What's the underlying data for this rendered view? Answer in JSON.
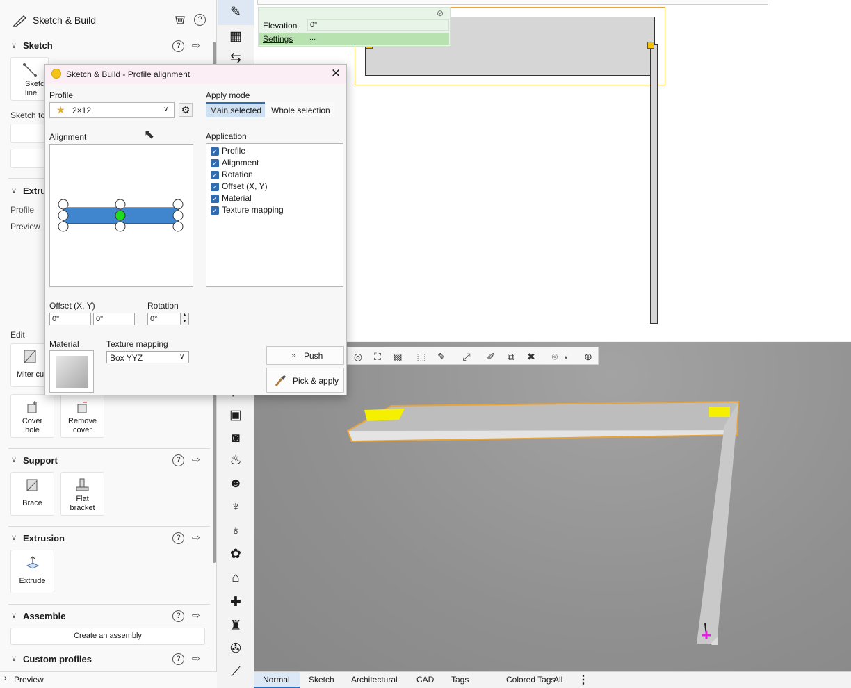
{
  "left_panel": {
    "app_title": "Sketch & Build",
    "sketch": {
      "title": "Sketch",
      "sketch_line_label": "Sketch line",
      "sketch_tools_label": "Sketch to"
    },
    "extrusion_top": {
      "title": "Extru",
      "profile_label": "Profile",
      "preview_label": "Preview"
    },
    "edit": {
      "title": "Edit",
      "miter_label": "Miter cu",
      "cover_hole_label": "Cover hole",
      "remove_cover_label": "Remove cover"
    },
    "support": {
      "title": "Support",
      "brace_label": "Brace",
      "flat_bracket_label": "Flat bracket"
    },
    "extrusion": {
      "title": "Extrusion",
      "extrude_label": "Extrude"
    },
    "assemble": {
      "title": "Assemble",
      "create_assembly_label": "Create an assembly"
    },
    "custom_profiles": {
      "title": "Custom profiles"
    },
    "preview_bar_label": "Preview"
  },
  "plan_view": {
    "settings_panel": {
      "elevation_label": "Elevation",
      "elevation_value": "0\"",
      "settings_label": "Settings",
      "settings_value": "..."
    }
  },
  "bottom_tabs": [
    "Normal",
    "Sketch",
    "Architectural",
    "CAD",
    "Tags",
    "Colored Tags",
    "All"
  ],
  "active_tab": "Normal",
  "dialog": {
    "title": "Sketch & Build - Profile alignment",
    "profile_label": "Profile",
    "profile_value": "2×12",
    "apply_mode_label": "Apply mode",
    "apply_modes": [
      "Main selected",
      "Whole selection"
    ],
    "active_apply_mode": "Main selected",
    "alignment_label": "Alignment",
    "selected_anchor": "center",
    "application_label": "Application",
    "application_items": [
      {
        "label": "Profile",
        "checked": true
      },
      {
        "label": "Alignment",
        "checked": true
      },
      {
        "label": "Rotation",
        "checked": true
      },
      {
        "label": "Offset (X, Y)",
        "checked": true
      },
      {
        "label": "Material",
        "checked": true
      },
      {
        "label": "Texture mapping",
        "checked": true
      }
    ],
    "offset_label": "Offset (X, Y)",
    "offset_x": "0\"",
    "offset_y": "0\"",
    "rotation_label": "Rotation",
    "rotation_value": "0°",
    "material_label": "Material",
    "texture_mapping_label": "Texture mapping",
    "texture_mapping_value": "Box YYZ",
    "push_label": "Push",
    "pick_apply_label": "Pick & apply"
  },
  "colors": {
    "profile_bar": "#3f86cf",
    "selected_anchor": "#1fdc1f",
    "dialog_title_bg": "#fbeef4",
    "settings_panel_bg": "#e7f4e7",
    "selection_outline": "#e8a23a",
    "highlight_yellow": "#f5f000",
    "checkbox": "#2f6db0"
  }
}
